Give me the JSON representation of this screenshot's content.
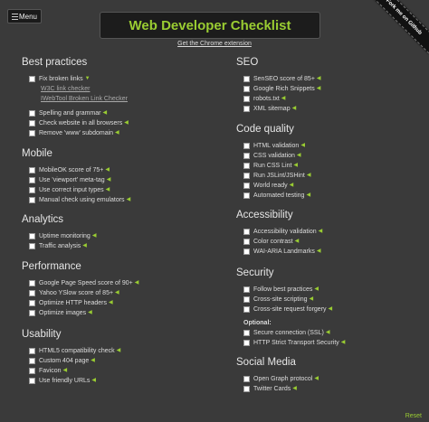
{
  "menu_label": "Menu",
  "title": "Web Developer Checklist",
  "chrome_extension_link": "Get the Chrome extension",
  "ribbon": "Fork me on Github",
  "reset": "Reset",
  "colors": {
    "accent": "#9acd32",
    "background": "#3a3a3a"
  },
  "left": [
    {
      "title": "Best practices",
      "items": [
        {
          "label": "Fix broken links",
          "arrow": "▼",
          "subs": [
            "W3C link checker",
            "IWebTool Broken Link Checker"
          ]
        },
        {
          "label": "Spelling and grammar"
        },
        {
          "label": "Check website in all browsers"
        },
        {
          "label": "Remove 'www' subdomain"
        }
      ]
    },
    {
      "title": "Mobile",
      "items": [
        {
          "label": "MobileOK score of 75+"
        },
        {
          "label": "Use 'viewport' meta-tag"
        },
        {
          "label": "Use correct input types"
        },
        {
          "label": "Manual check using emulators"
        }
      ]
    },
    {
      "title": "Analytics",
      "items": [
        {
          "label": "Uptime monitoring"
        },
        {
          "label": "Traffic analysis"
        }
      ]
    },
    {
      "title": "Performance",
      "items": [
        {
          "label": "Google Page Speed score of 90+"
        },
        {
          "label": "Yahoo YSlow score of 85+"
        },
        {
          "label": "Optimize HTTP headers"
        },
        {
          "label": "Optimize images"
        }
      ]
    },
    {
      "title": "Usability",
      "items": [
        {
          "label": "HTML5 compatibility check"
        },
        {
          "label": "Custom 404 page"
        },
        {
          "label": "Favicon"
        },
        {
          "label": "Use friendly URLs"
        }
      ]
    }
  ],
  "right": [
    {
      "title": "SEO",
      "items": [
        {
          "label": "SenSEO score of 85+"
        },
        {
          "label": "Google Rich Snippets"
        },
        {
          "label": "robots.txt"
        },
        {
          "label": "XML sitemap"
        }
      ]
    },
    {
      "title": "Code quality",
      "items": [
        {
          "label": "HTML validation"
        },
        {
          "label": "CSS validation"
        },
        {
          "label": "Run CSS Lint"
        },
        {
          "label": "Run JSLint/JSHint"
        },
        {
          "label": "World ready"
        },
        {
          "label": "Automated testing"
        }
      ]
    },
    {
      "title": "Accessibility",
      "items": [
        {
          "label": "Accessibility validation"
        },
        {
          "label": "Color contrast"
        },
        {
          "label": "WAI-ARIA Landmarks"
        }
      ]
    },
    {
      "title": "Security",
      "items": [
        {
          "label": "Follow best practices"
        },
        {
          "label": "Cross-site scripting"
        },
        {
          "label": "Cross-site request forgery"
        }
      ],
      "optional_label": "Optional:",
      "optional_items": [
        {
          "label": "Secure connection (SSL)"
        },
        {
          "label": "HTTP Strict Transport Security"
        }
      ]
    },
    {
      "title": "Social Media",
      "items": [
        {
          "label": "Open Graph protocol"
        },
        {
          "label": "Twitter Cards"
        }
      ]
    }
  ]
}
